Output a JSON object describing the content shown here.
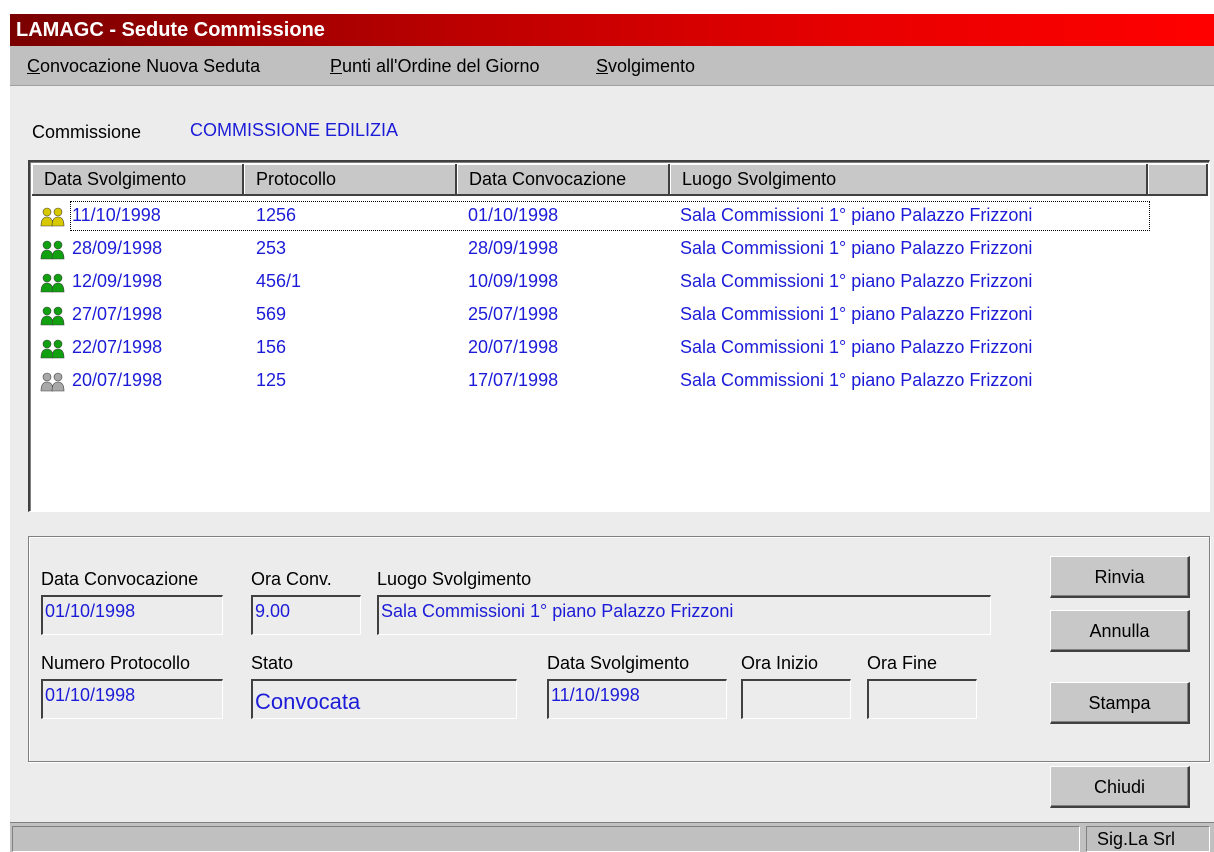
{
  "window": {
    "title": "LAMAGC - Sedute Commissione"
  },
  "menu": [
    {
      "accel": "C",
      "rest": "onvocazione Nuova Seduta"
    },
    {
      "accel": "P",
      "rest": "unti all'Ordine del Giorno"
    },
    {
      "accel": "S",
      "rest": "volgimento"
    }
  ],
  "commission": {
    "label": "Commissione",
    "value": "COMMISSIONE EDILIZIA"
  },
  "list": {
    "columns": [
      "Data Svolgimento",
      "Protocollo",
      "Data Convocazione",
      "Luogo Svolgimento"
    ],
    "rows": [
      {
        "icon": "people-yellow-icon",
        "color": "#d8c800",
        "data_svolgimento": "11/10/1998",
        "protocollo": "1256",
        "data_convocazione": "01/10/1998",
        "luogo": "Sala Commissioni 1° piano Palazzo Frizzoni"
      },
      {
        "icon": "people-green-icon",
        "color": "#10a010",
        "data_svolgimento": "28/09/1998",
        "protocollo": "253",
        "data_convocazione": "28/09/1998",
        "luogo": "Sala Commissioni 1° piano Palazzo Frizzoni"
      },
      {
        "icon": "people-green-icon",
        "color": "#10a010",
        "data_svolgimento": "12/09/1998",
        "protocollo": "456/1",
        "data_convocazione": "10/09/1998",
        "luogo": "Sala Commissioni 1° piano Palazzo Frizzoni"
      },
      {
        "icon": "people-green-icon",
        "color": "#10a010",
        "data_svolgimento": "27/07/1998",
        "protocollo": "569",
        "data_convocazione": "25/07/1998",
        "luogo": "Sala Commissioni 1° piano Palazzo Frizzoni"
      },
      {
        "icon": "people-green-icon",
        "color": "#10a010",
        "data_svolgimento": "22/07/1998",
        "protocollo": "156",
        "data_convocazione": "20/07/1998",
        "luogo": "Sala Commissioni 1° piano Palazzo Frizzoni"
      },
      {
        "icon": "people-gray-icon",
        "color": "#a8a8a8",
        "data_svolgimento": "20/07/1998",
        "protocollo": "125",
        "data_convocazione": "17/07/1998",
        "luogo": "Sala Commissioni 1° piano Palazzo Frizzoni"
      }
    ]
  },
  "details": {
    "data_convocazione": {
      "label": "Data Convocazione",
      "value": "01/10/1998"
    },
    "ora_conv": {
      "label": "Ora Conv.",
      "value": "9.00"
    },
    "luogo": {
      "label": "Luogo Svolgimento",
      "value": "Sala Commissioni 1° piano Palazzo Frizzoni"
    },
    "numero_protocollo": {
      "label": "Numero Protocollo",
      "value": "01/10/1998"
    },
    "stato": {
      "label": "Stato",
      "value": "Convocata"
    },
    "data_svolgimento": {
      "label": "Data Svolgimento",
      "value": "11/10/1998"
    },
    "ora_inizio": {
      "label": "Ora Inizio",
      "value": ""
    },
    "ora_fine": {
      "label": "Ora Fine",
      "value": ""
    }
  },
  "buttons": {
    "rinvia": "Rinvia",
    "annulla": "Annulla",
    "stampa": "Stampa",
    "chiudi": "Chiudi"
  },
  "status": {
    "company": "Sig.La Srl"
  },
  "colors": {
    "value_text": "#1c1cd8",
    "title_start": "#7a0000",
    "title_end": "#ff0000"
  }
}
